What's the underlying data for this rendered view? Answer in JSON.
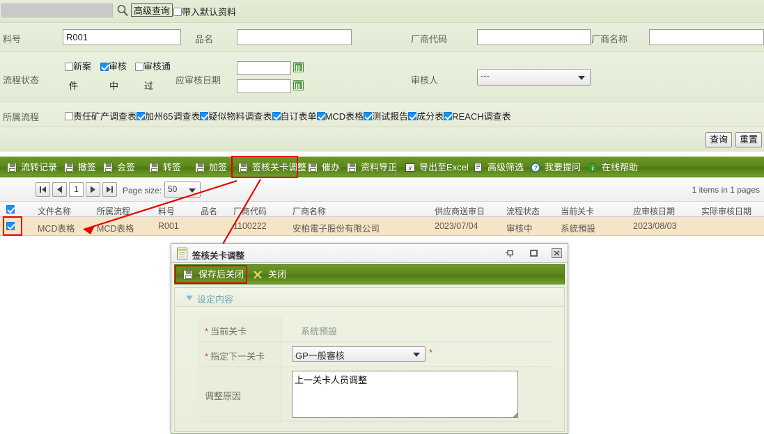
{
  "search": {
    "value": "",
    "placeholder": "",
    "magnifier_icon": "search-icon",
    "advanced_query_label": "高级查询",
    "default_data_checkbox": {
      "label": "带入默认资料",
      "checked": false
    }
  },
  "query_form": {
    "fields": {
      "material_no": {
        "label": "料号",
        "value": "R001"
      },
      "product_name": {
        "label": "品名",
        "value": ""
      },
      "vendor_code": {
        "label": "厂商代码",
        "value": ""
      },
      "vendor_name": {
        "label": "厂商名称",
        "value": ""
      }
    },
    "process_status": {
      "label": "流程状态",
      "options": [
        {
          "label": "新案件",
          "line1": "新案",
          "line2": "件",
          "checked": false
        },
        {
          "label": "审核中",
          "line1": "审核",
          "line2": "中",
          "checked": true
        },
        {
          "label": "审核通过",
          "line1": "审核通",
          "line2": "过",
          "checked": false
        }
      ]
    },
    "review_date": {
      "label": "应审核日期",
      "from": "",
      "to": "",
      "icon": "calendar-icon"
    },
    "reviewer": {
      "label": "审核人",
      "value": "---"
    },
    "belong_process": {
      "label": "所属流程",
      "options": [
        {
          "label": "责任矿产调查表",
          "checked": false
        },
        {
          "label": "加州65调查表",
          "checked": true
        },
        {
          "label": "疑似物料调查表",
          "checked": true
        },
        {
          "label": "自订表单",
          "checked": true
        },
        {
          "label": "MCD表格",
          "checked": true
        },
        {
          "label": "测试报告",
          "checked": true
        },
        {
          "label": "成分表",
          "checked": true
        },
        {
          "label": "REACH调查表",
          "checked": true
        }
      ]
    },
    "actions": {
      "query": "查询",
      "reset": "重置"
    }
  },
  "toolbar": {
    "items": [
      {
        "label": "流转记录",
        "icon": "save-disk-icon",
        "highlighted": false
      },
      {
        "label": "撤签",
        "icon": "save-disk-icon",
        "highlighted": false
      },
      {
        "label": "会签",
        "icon": "save-disk-icon",
        "highlighted": false
      },
      {
        "label": "转签",
        "icon": "save-disk-icon",
        "highlighted": false
      },
      {
        "label": "加签",
        "icon": "save-disk-icon",
        "highlighted": false
      },
      {
        "label": "签核关卡调整",
        "icon": "save-disk-icon",
        "highlighted": true
      },
      {
        "label": "催办",
        "icon": "save-disk-icon",
        "highlighted": false
      },
      {
        "label": "资料导正",
        "icon": "save-disk-icon",
        "highlighted": false
      },
      {
        "label": "导出至Excel",
        "icon": "excel-export-icon",
        "highlighted": false
      },
      {
        "label": "高级筛选",
        "icon": "filter-icon",
        "highlighted": false
      },
      {
        "label": "我要提问",
        "icon": "question-icon",
        "highlighted": false
      },
      {
        "label": "在线帮助",
        "icon": "info-icon",
        "highlighted": false
      }
    ]
  },
  "pager": {
    "first": "first-page-icon",
    "prev": "prev-page-icon",
    "current_page": "1",
    "next": "next-page-icon",
    "last": "last-page-icon",
    "page_size_label": "Page size:",
    "page_size_value": "50",
    "items_info": "1 items in 1 pages"
  },
  "grid": {
    "select_all_checked": true,
    "columns": [
      "文件名称",
      "所属流程",
      "料号",
      "品名",
      "厂商代码",
      "厂商名称",
      "供应商送审日",
      "流程状态",
      "当前关卡",
      "应审核日期",
      "实际审核日期"
    ],
    "rows": [
      {
        "checked": true,
        "cells": [
          "MCD表格",
          "MCD表格",
          "R001",
          "",
          "1100222",
          "安柏電子股份有限公司",
          "2023/07/04",
          "审核中",
          "系統預設",
          "2023/08/03",
          ""
        ]
      }
    ]
  },
  "modal": {
    "title": "签核关卡调整",
    "title_icon": "document-icon",
    "window_buttons": [
      {
        "name": "pin-icon"
      },
      {
        "name": "maximize-icon"
      },
      {
        "name": "close-icon"
      }
    ],
    "toolbar": [
      {
        "label": "保存后关闭",
        "icon": "save-disk-icon",
        "highlighted": true
      },
      {
        "label": "关闭",
        "icon": "close-x-icon",
        "highlighted": false
      }
    ],
    "section_title": "设定内容",
    "section_icon": "collapse-triangle-icon",
    "fields": {
      "current_gate": {
        "label": "当前关卡",
        "required": true,
        "value": "系統預設"
      },
      "next_gate": {
        "label": "指定下一关卡",
        "required": true,
        "value": "GP一般審核",
        "trailing_required": "*"
      },
      "reason": {
        "label": "调整原因",
        "required": false,
        "value": "上一关卡人员调整"
      }
    }
  },
  "colors": {
    "toolbar_green": "#5d8a1d",
    "highlight_red": "#e60000",
    "row_highlight": "#f6e4c6",
    "panel_green": "#e6ecd8",
    "section_teal": "#6aa8b4",
    "required_red": "#d63a25",
    "checkbox_blue": "#1e90f5"
  }
}
